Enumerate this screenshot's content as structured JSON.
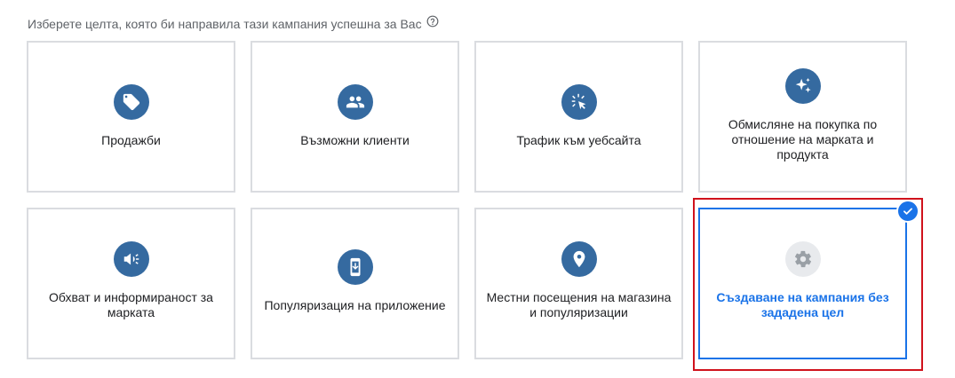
{
  "heading": {
    "text": "Изберете целта, която би направила тази кампания успешна за Вас",
    "help_icon": "help-circle-icon"
  },
  "goals": [
    {
      "label": "Продажби",
      "icon": "sale-tag-icon",
      "selected": false
    },
    {
      "label": "Възможни клиенти",
      "icon": "people-icon",
      "selected": false
    },
    {
      "label": "Трафик към уебсайта",
      "icon": "cursor-click-icon",
      "selected": false
    },
    {
      "label": "Обмисляне на покупка по отношение на марката и продукта",
      "icon": "sparkle-icon",
      "selected": false
    },
    {
      "label": "Обхват и информираност за марката",
      "icon": "megaphone-icon",
      "selected": false
    },
    {
      "label": "Популяризация на приложение",
      "icon": "mobile-app-icon",
      "selected": false
    },
    {
      "label": "Местни посещения на магазина и популяризации",
      "icon": "location-pin-icon",
      "selected": false
    },
    {
      "label": "Създаване на кампания без зададена цел",
      "icon": "gear-icon",
      "selected": true
    }
  ],
  "colors": {
    "icon_background": "#356aa0",
    "selected_accent": "#1a73e8",
    "highlight_border": "#d0121c"
  }
}
